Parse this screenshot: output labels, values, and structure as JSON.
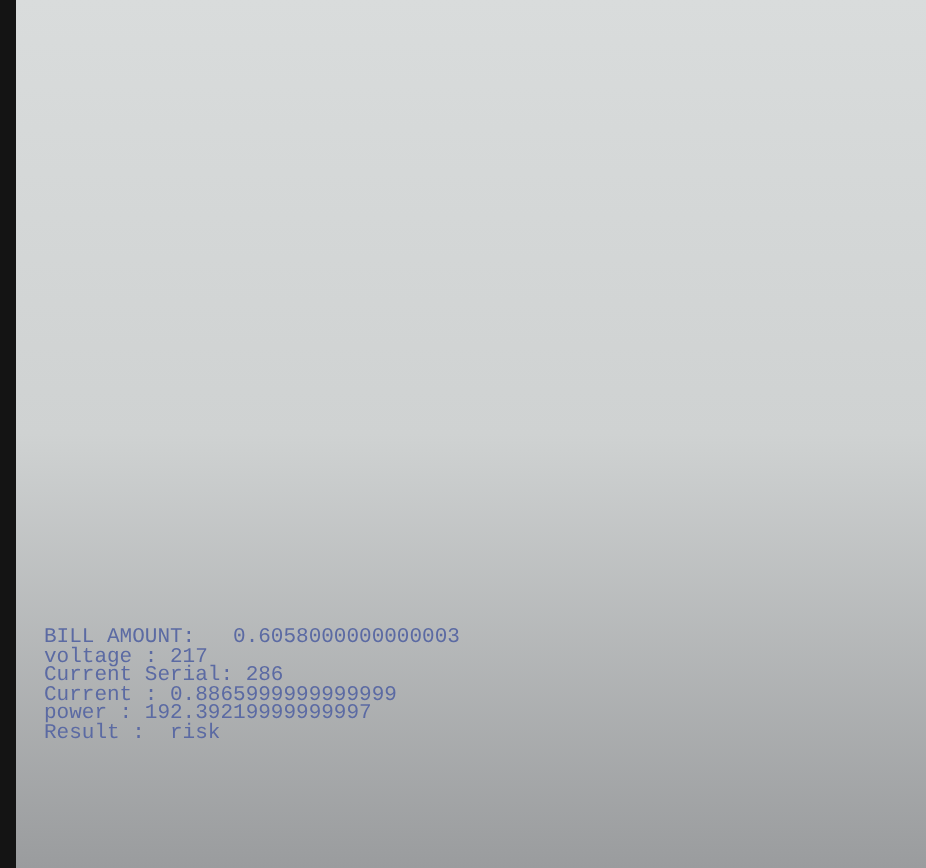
{
  "console": {
    "lines": [
      {
        "text": "BILL AMOUNT:   0.6058000000000003"
      },
      {
        "text": "voltage : 217"
      },
      {
        "text": "Current Serial: 286"
      },
      {
        "text": "Current : 0.8865999999999999"
      },
      {
        "text": "power : 192.39219999999997"
      },
      {
        "text": "Result :  risk"
      }
    ]
  }
}
